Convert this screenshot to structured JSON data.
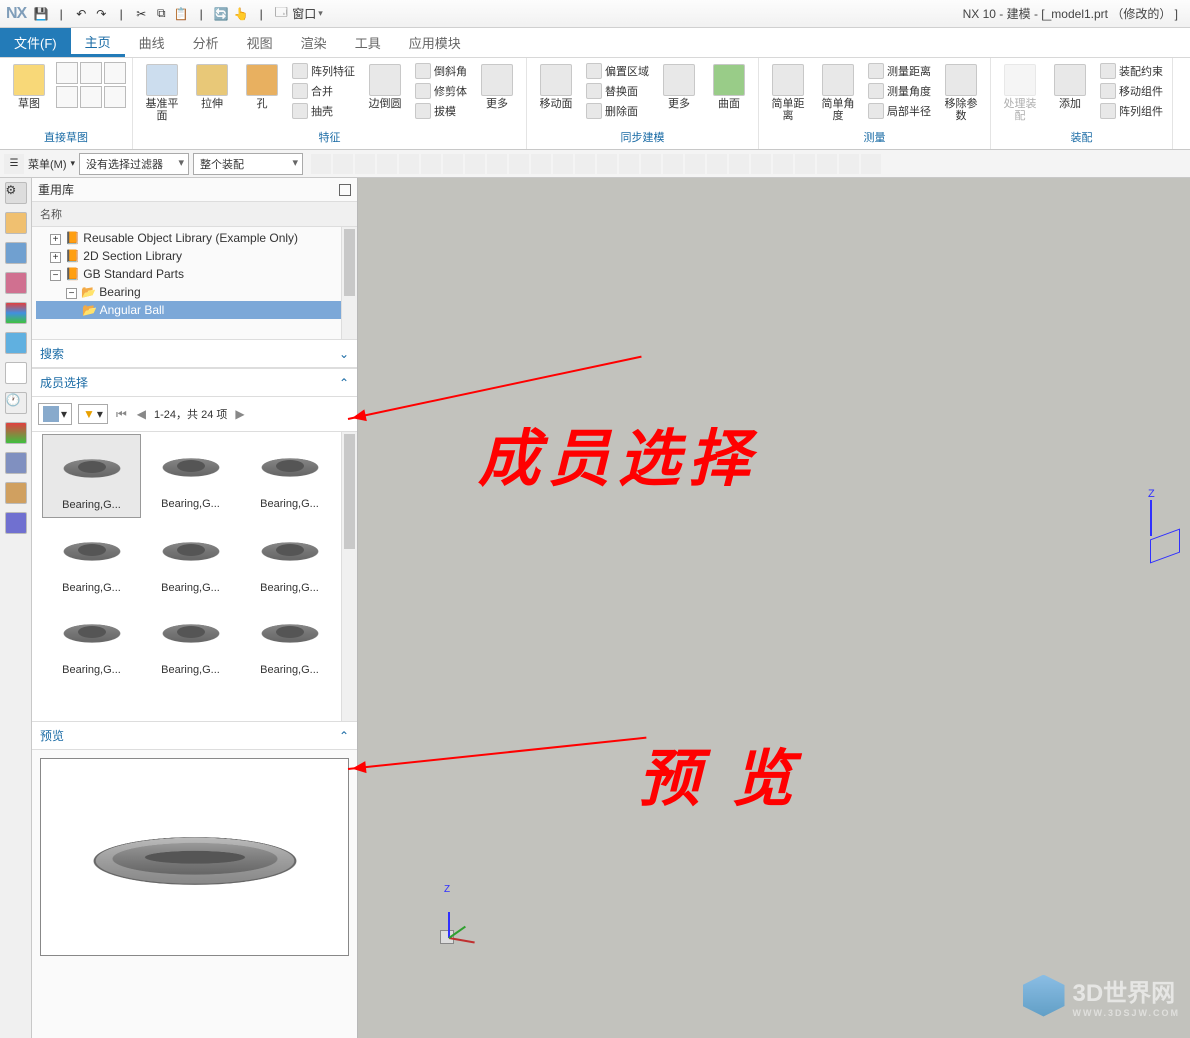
{
  "title": "NX 10 - 建模 - [_model1.prt  （修改的） ]",
  "app_logo": "NX",
  "qat": {
    "window_menu": "窗口"
  },
  "menu": {
    "file": "文件(F)",
    "tabs": [
      "主页",
      "曲线",
      "分析",
      "视图",
      "渲染",
      "工具",
      "应用模块"
    ],
    "active": 0
  },
  "ribbon": {
    "g1": {
      "label": "直接草图",
      "sketch": "草图"
    },
    "g2": {
      "label": "",
      "datum": "基准平面",
      "extrude": "拉伸",
      "hole": "孔",
      "r": [
        "阵列特征",
        "合并",
        "抽壳"
      ]
    },
    "g3": {
      "label": "特征",
      "edge": "边倒圆",
      "r": [
        "倒斜角",
        "修剪体",
        "拔模"
      ],
      "more": "更多"
    },
    "g4": {
      "label": "",
      "mf": "移动面",
      "r": [
        "偏置区域",
        "替换面",
        "删除面"
      ],
      "more": "更多"
    },
    "g5": {
      "label": "同步建模",
      "surf": "曲面"
    },
    "g6": {
      "label": "",
      "sd": "简单距离",
      "sa": "简单角度",
      "r": [
        "测量距离",
        "测量角度",
        "局部半径"
      ]
    },
    "g7": {
      "label": "测量",
      "rp": "移除参数"
    },
    "g8": {
      "label": "",
      "ha": "处理装配",
      "add": "添加",
      "r": [
        "装配约束",
        "移动组件",
        "阵列组件"
      ]
    },
    "g9": {
      "label": "装配"
    }
  },
  "selbar": {
    "menu": "菜单(M)",
    "filter": "没有选择过滤器",
    "scope": "整个装配"
  },
  "panel": {
    "title": "重用库",
    "tree_hdr": "名称",
    "tree": [
      {
        "t": "Reusable Object Library (Example Only)",
        "l": 1,
        "exp": "+"
      },
      {
        "t": "2D Section Library",
        "l": 1,
        "exp": "+"
      },
      {
        "t": "GB Standard Parts",
        "l": 1,
        "exp": "−"
      },
      {
        "t": "Bearing",
        "l": 2,
        "exp": "−",
        "fld": true
      },
      {
        "t": "Angular Ball",
        "l": 3,
        "sel": true,
        "fld": true
      }
    ],
    "search": "搜索",
    "member": "成员选择",
    "page": "1-24，共 24 项",
    "items": [
      "Bearing,G...",
      "Bearing,G...",
      "Bearing,G...",
      "Bearing,G...",
      "Bearing,G...",
      "Bearing,G...",
      "Bearing,G...",
      "Bearing,G...",
      "Bearing,G..."
    ],
    "preview": "预览"
  },
  "annot": {
    "a1": "成员选择",
    "a2": "预 览"
  },
  "watermark": {
    "t": "3D世界网",
    "s": "WWW.3DSJW.COM"
  }
}
